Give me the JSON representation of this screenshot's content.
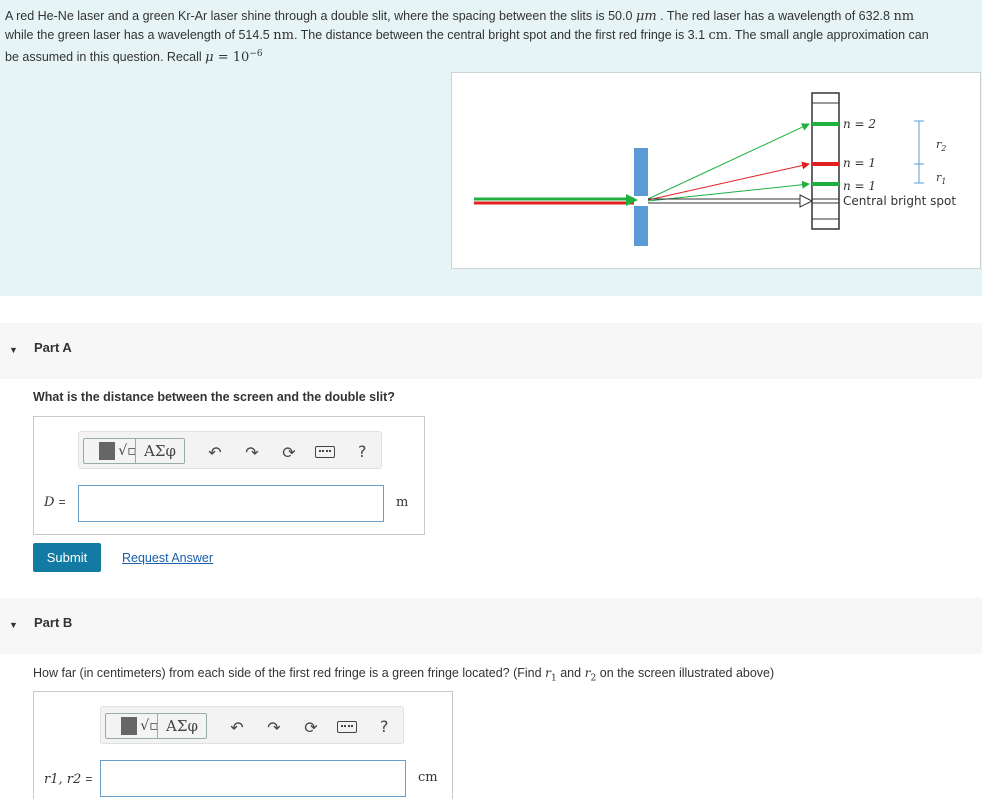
{
  "problem": {
    "line1_a": "A red He-Ne laser and a green Kr-Ar laser shine through a double slit, where the spacing between the slits is 50.0 ",
    "line1_unit": "μm",
    "line1_b": " . The red laser has a wavelength of 632.8 ",
    "line1_unit2": "nm",
    "line2_a": "while the green laser has a wavelength of 514.5 ",
    "line2_unit": "nm",
    "line2_b": ". The distance between the central bright spot and the first red fringe is 3.1 ",
    "line2_unit2": "cm",
    "line2_c": ". The small angle approximation can",
    "line3_a": "be assumed in this question. Recall ",
    "line3_mu": "μ",
    "line3_eq": " = 10",
    "line3_exp": "−6"
  },
  "figure": {
    "label_n2": "n = 2",
    "label_n1_red": "n = 1",
    "label_n1_green": "n = 1",
    "label_central": "Central bright spot",
    "label_r2": "r2",
    "label_r1": "r1",
    "colors": {
      "red": "#e02020",
      "green": "#20b040",
      "slit": "#5b9bd5"
    }
  },
  "partA": {
    "caret": "▼",
    "title": "Part A",
    "question": "What is the distance between the screen and the double slit?",
    "toolbar": {
      "greek": "ΑΣφ",
      "help": "?"
    },
    "var_label": "D",
    "eq": "=",
    "value": "",
    "unit": "m",
    "submit_label": "Submit",
    "request_label": "Request Answer"
  },
  "partB": {
    "caret": "▼",
    "title": "Part B",
    "question_a": "How far (in centimeters) from each side of the first red fringe is a green fringe located? (Find ",
    "question_r1": "r",
    "question_r1_sub": "1",
    "question_and": " and ",
    "question_r2": "r",
    "question_r2_sub": "2",
    "question_b": " on the screen illustrated above)",
    "toolbar": {
      "greek": "ΑΣφ",
      "help": "?"
    },
    "var_label": "r1, r2",
    "eq": "=",
    "value": "",
    "unit": "cm"
  }
}
